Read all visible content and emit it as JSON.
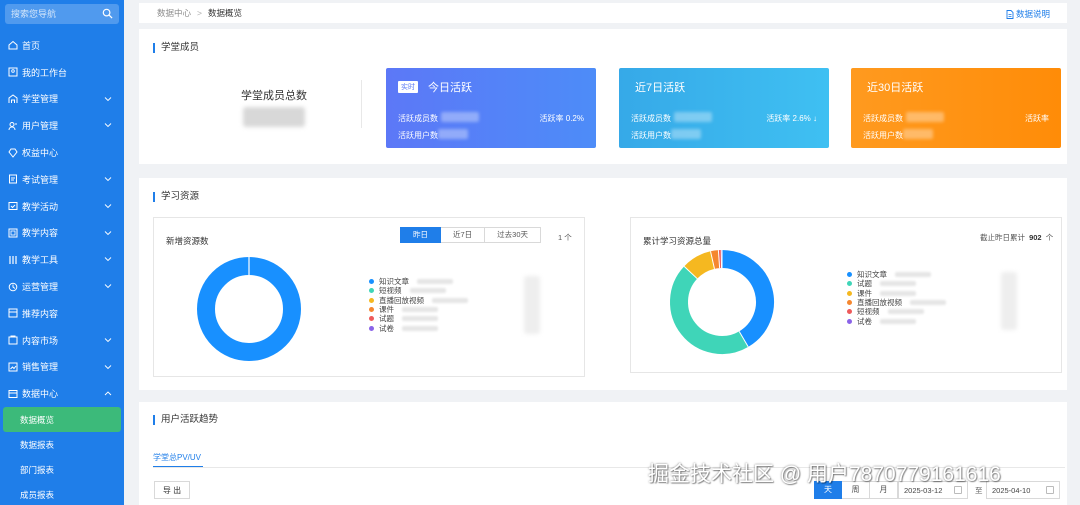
{
  "search": {
    "placeholder": "搜索您导航"
  },
  "sidebar": {
    "items": [
      {
        "label": "首页",
        "icon": "home-icon",
        "expandable": false
      },
      {
        "label": "我的工作台",
        "icon": "workbench-icon",
        "expandable": false
      },
      {
        "label": "学堂管理",
        "icon": "school-icon",
        "expandable": true
      },
      {
        "label": "用户管理",
        "icon": "users-icon",
        "expandable": true
      },
      {
        "label": "权益中心",
        "icon": "diamond-icon",
        "expandable": false
      },
      {
        "label": "考试管理",
        "icon": "exam-icon",
        "expandable": true
      },
      {
        "label": "教学活动",
        "icon": "activity-icon",
        "expandable": true
      },
      {
        "label": "教学内容",
        "icon": "content-icon",
        "expandable": true
      },
      {
        "label": "教学工具",
        "icon": "tools-icon",
        "expandable": true
      },
      {
        "label": "运营管理",
        "icon": "operations-icon",
        "expandable": true
      },
      {
        "label": "推荐内容",
        "icon": "recommend-icon",
        "expandable": false
      },
      {
        "label": "内容市场",
        "icon": "market-icon",
        "expandable": true
      },
      {
        "label": "销售管理",
        "icon": "sales-icon",
        "expandable": true
      },
      {
        "label": "数据中心",
        "icon": "data-icon",
        "expandable": true,
        "expanded": true
      }
    ],
    "sub_items": [
      {
        "label": "数据概览",
        "active": true
      },
      {
        "label": "数据报表",
        "active": false
      },
      {
        "label": "部门报表",
        "active": false
      },
      {
        "label": "成员报表",
        "active": false
      }
    ]
  },
  "breadcrumb": {
    "parent": "数据中心",
    "separator": ">",
    "current": "数据概览"
  },
  "doc_link": "数据说明",
  "members": {
    "section_title": "学堂成员",
    "total_label": "学堂成员总数",
    "cards": [
      {
        "tag": "实时",
        "title": "今日活跃",
        "members_label": "活跃成员数",
        "users_label": "活跃用户数",
        "rate_label": "活跃率 0.2%",
        "color_start": "#5c78f7",
        "color_end": "#4d8cf8"
      },
      {
        "tag": "",
        "title": "近7日活跃",
        "members_label": "活跃成员数",
        "users_label": "活跃用户数",
        "rate_label": "活跃率 2.6% ↓",
        "color_start": "#36a9e8",
        "color_end": "#3fc0f2"
      },
      {
        "tag": "",
        "title": "近30日活跃",
        "members_label": "活跃成员数",
        "users_label": "活跃用户数",
        "rate_label": "活跃率",
        "color_start": "#ff9a1f",
        "color_end": "#ff8c08"
      }
    ]
  },
  "resources": {
    "section_title": "学习资源",
    "new_panel": {
      "title": "新增资源数",
      "tabs": [
        "昨日",
        "近7日",
        "过去30天"
      ],
      "active_tab": 0,
      "count_label": "1 个",
      "legend": [
        {
          "label": "知识文章",
          "color": "#1890ff"
        },
        {
          "label": "短视频",
          "color": "#3fd5b8"
        },
        {
          "label": "直播回放视频",
          "color": "#f5b820"
        },
        {
          "label": "课件",
          "color": "#f5872f"
        },
        {
          "label": "试题",
          "color": "#ee5a5a"
        },
        {
          "label": "试卷",
          "color": "#8a63e8"
        }
      ]
    },
    "total_panel": {
      "title": "累计学习资源总量",
      "summary_prefix": "截止昨日累计",
      "summary_value": "902",
      "summary_unit": "个",
      "legend": [
        {
          "label": "知识文章",
          "color": "#1890ff"
        },
        {
          "label": "试题",
          "color": "#3fd5b8"
        },
        {
          "label": "课件",
          "color": "#f5b820"
        },
        {
          "label": "直播回放视频",
          "color": "#f5872f"
        },
        {
          "label": "短视频",
          "color": "#ee5a5a"
        },
        {
          "label": "试卷",
          "color": "#8a63e8"
        }
      ]
    }
  },
  "trend": {
    "section_title": "用户活跃趋势",
    "tab_label": "学堂总PV/UV",
    "export_label": "导 出",
    "range_tabs": [
      "天",
      "周",
      "月"
    ],
    "active_range": 0,
    "date_start": "2025-03-12",
    "date_to": "至",
    "date_end": "2025-04-10"
  },
  "watermark": "掘金技术社区 @ 用户7870779161616",
  "chart_data": [
    {
      "type": "pie",
      "title": "新增资源数",
      "categories": [
        "知识文章"
      ],
      "values": [
        1
      ]
    },
    {
      "type": "pie",
      "title": "累计学习资源总量",
      "categories": [
        "知识文章",
        "试题",
        "课件",
        "直播回放视频",
        "短视频",
        "试卷"
      ],
      "values": [
        375,
        410,
        85,
        22,
        8,
        2
      ]
    }
  ]
}
